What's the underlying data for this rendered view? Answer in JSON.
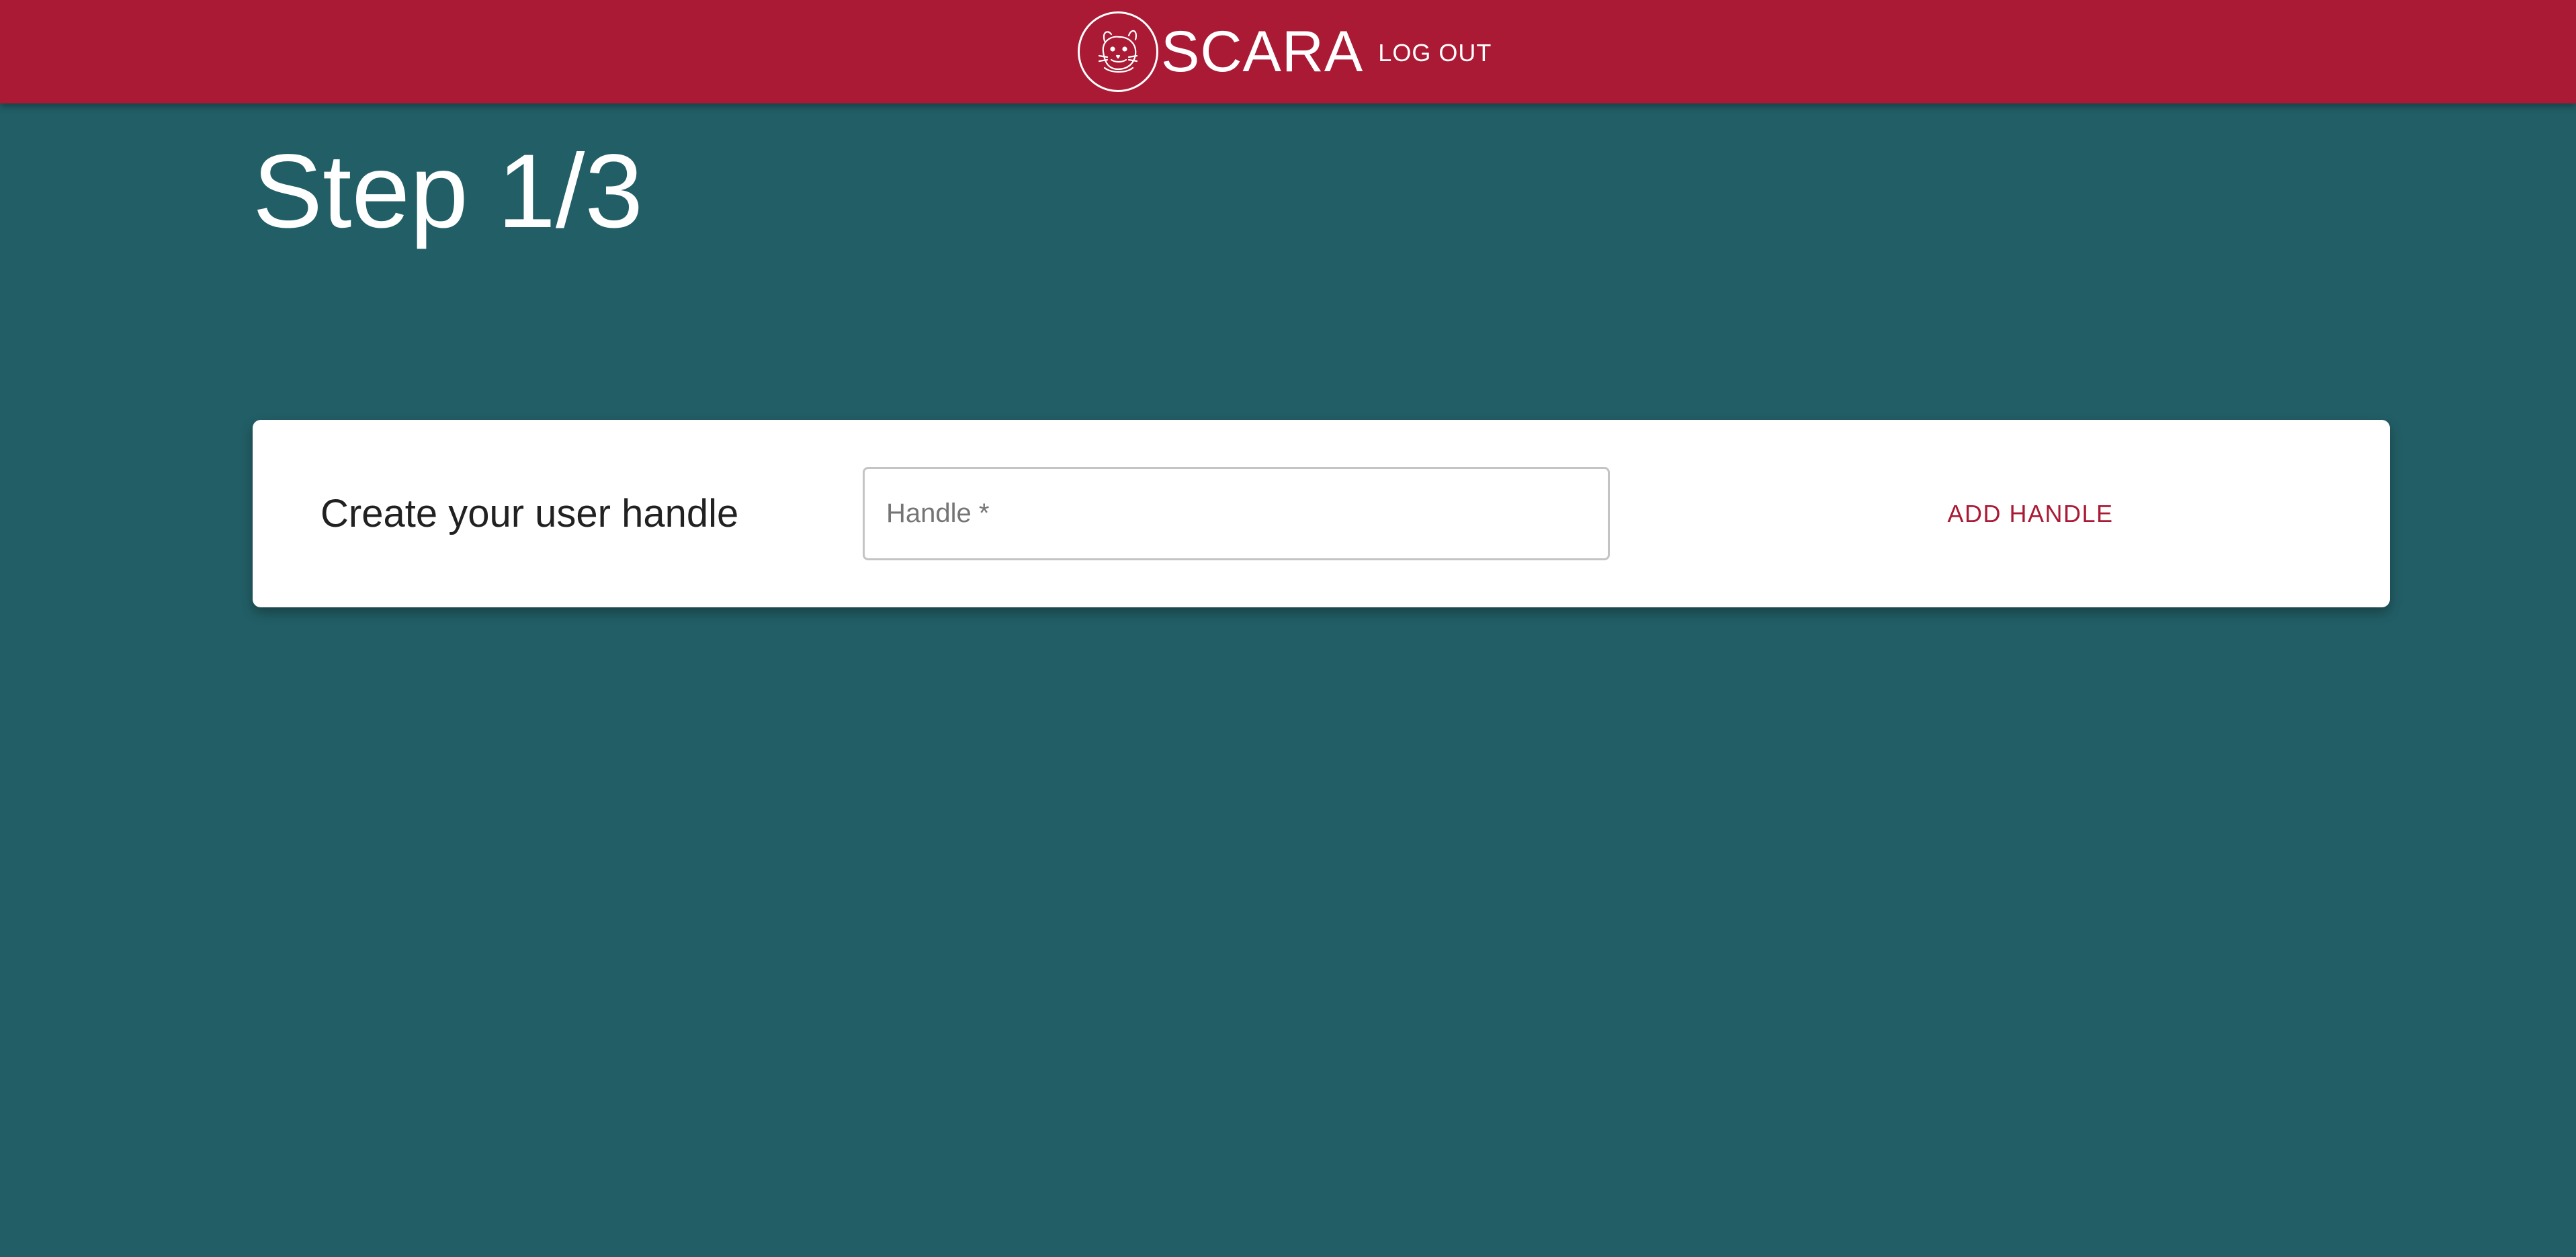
{
  "header": {
    "app_name": "SCARA",
    "logout_label": "LOG OUT",
    "logo_icon": "hamster-logo-icon",
    "background_color": "#ab1a35"
  },
  "page": {
    "title": "Step 1/3",
    "background_color": "#225e66"
  },
  "handle_card": {
    "label": "Create your user handle",
    "input_value": "",
    "input_placeholder": "Handle *",
    "add_button_label": "ADD HANDLE",
    "accent_color": "#ab1a35"
  }
}
